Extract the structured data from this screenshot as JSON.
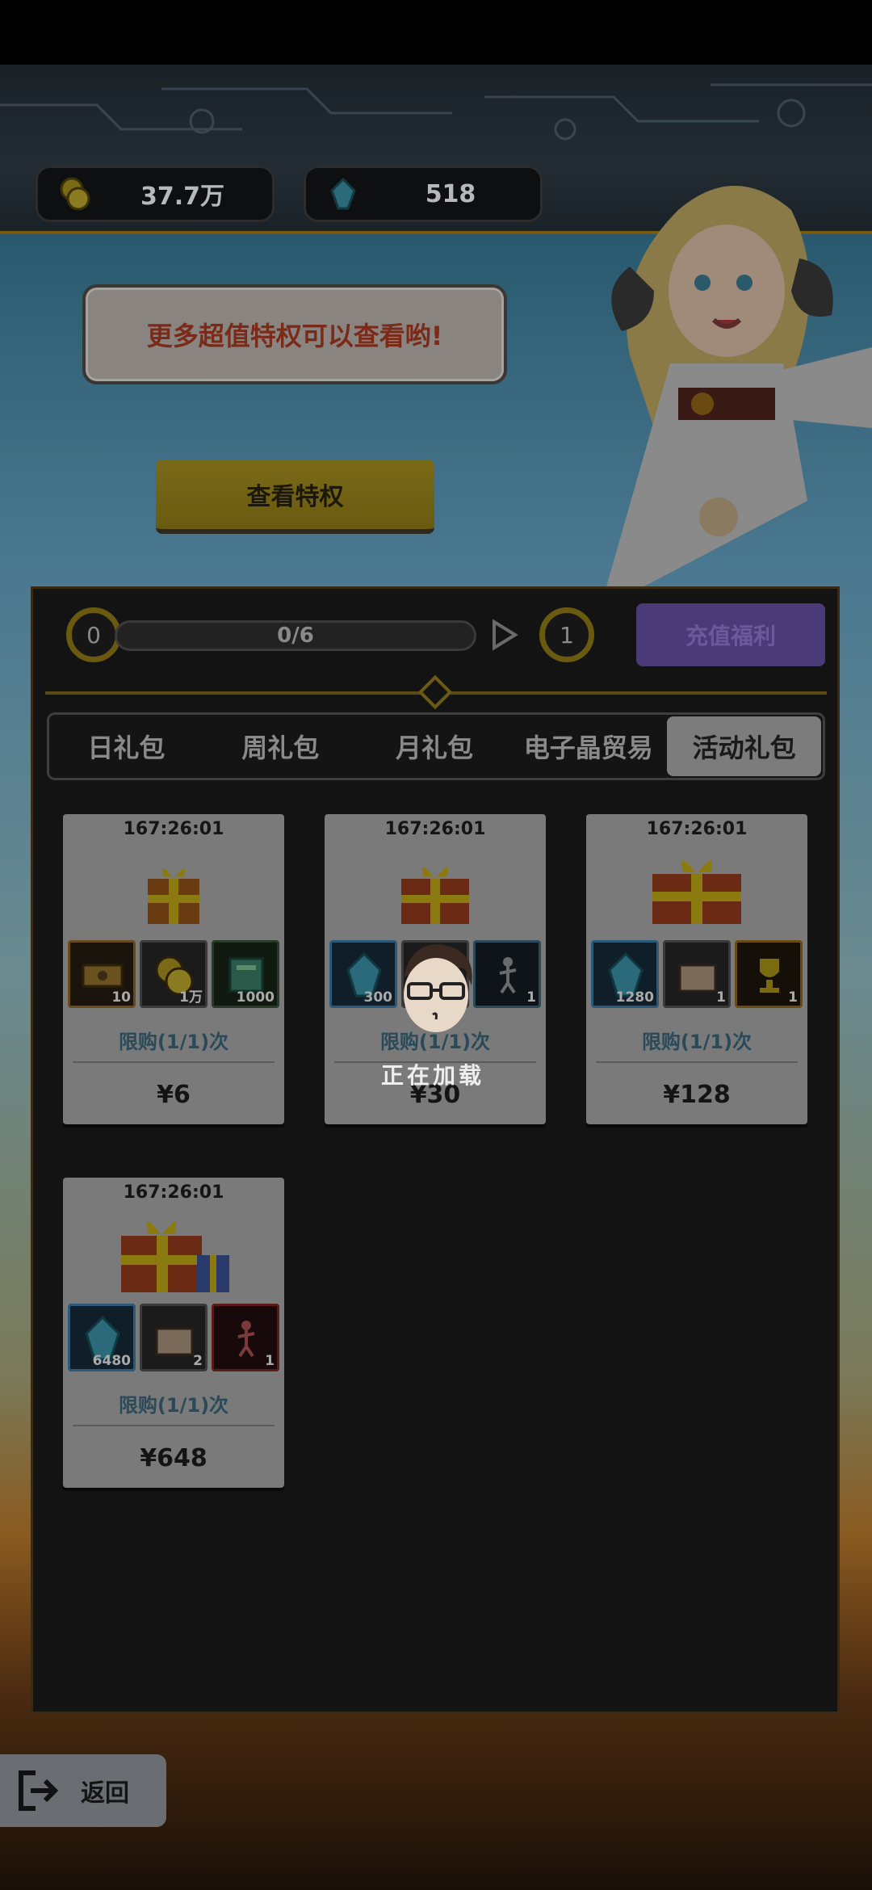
{
  "resources": {
    "gold": {
      "value": "37.7万",
      "icon": "gold-coin-icon"
    },
    "gems": {
      "value": "518",
      "icon": "crystal-icon"
    }
  },
  "banner": {
    "speech": "更多超值特权可以查看哟!",
    "view_button": "查看特权"
  },
  "progress": {
    "start": "0",
    "end": "1",
    "text": "0/6",
    "fraction": 0,
    "recharge_button": "充值福利"
  },
  "tabs": [
    {
      "label": "日礼包",
      "active": false
    },
    {
      "label": "周礼包",
      "active": false
    },
    {
      "label": "月礼包",
      "active": false
    },
    {
      "label": "电子晶贸易",
      "active": false
    },
    {
      "label": "活动礼包",
      "active": true
    }
  ],
  "packs": [
    {
      "timer": "167:26:01",
      "items": [
        {
          "icon": "ticket-icon",
          "count": "10"
        },
        {
          "icon": "gold-coin-icon",
          "count": "1万"
        },
        {
          "icon": "book-icon",
          "count": "1000"
        }
      ],
      "limit": "限购(1/1)次",
      "price": "¥6"
    },
    {
      "timer": "167:26:01",
      "items": [
        {
          "icon": "crystal-icon",
          "count": "300"
        },
        {
          "icon": "chest-icon",
          "count": ""
        },
        {
          "icon": "figure-icon",
          "count": "1"
        }
      ],
      "limit": "限购(1/1)次",
      "price": "¥30"
    },
    {
      "timer": "167:26:01",
      "items": [
        {
          "icon": "crystal-icon",
          "count": "1280"
        },
        {
          "icon": "chest-icon",
          "count": "1"
        },
        {
          "icon": "trophy-icon",
          "count": "1"
        }
      ],
      "limit": "限购(1/1)次",
      "price": "¥128"
    },
    {
      "timer": "167:26:01",
      "items": [
        {
          "icon": "crystal-icon",
          "count": "6480"
        },
        {
          "icon": "chest-icon",
          "count": "2"
        },
        {
          "icon": "figure-icon",
          "count": "1"
        }
      ],
      "limit": "限购(1/1)次",
      "price": "¥648"
    }
  ],
  "loading": {
    "text": "正在加载"
  },
  "back_button": "返回",
  "colors": {
    "accent_gold": "#6a5a10",
    "recharge_purple": "#4a3a78",
    "limit_text": "#2a4a5a"
  }
}
